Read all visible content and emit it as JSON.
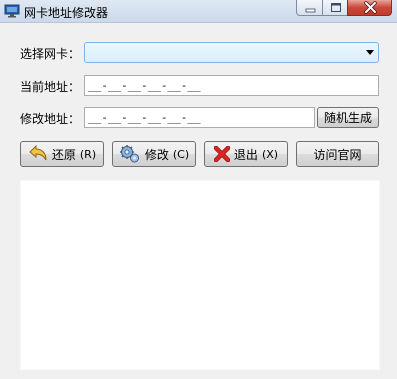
{
  "window": {
    "title": "网卡地址修改器"
  },
  "form": {
    "select_nic_label": "选择网卡：",
    "select_nic_value": "",
    "current_mac_label": "当前地址：",
    "current_mac_value": "__-__-__-__-__-__",
    "new_mac_label": "修改地址：",
    "new_mac_value": "__-__-__-__-__-__",
    "random_button": "随机生成"
  },
  "actions": {
    "restore_label": "还原",
    "restore_shortcut": "(R)",
    "modify_label": "修改",
    "modify_shortcut": "(C)",
    "exit_label": "退出",
    "exit_shortcut": "(X)",
    "website_label": "访问官网"
  },
  "icons": {
    "restore": "undo-arrow-icon",
    "modify": "gears-icon",
    "exit": "red-x-icon"
  },
  "colors": {
    "combo_border": "#7eb4ea",
    "close_button": "#c9473a"
  }
}
